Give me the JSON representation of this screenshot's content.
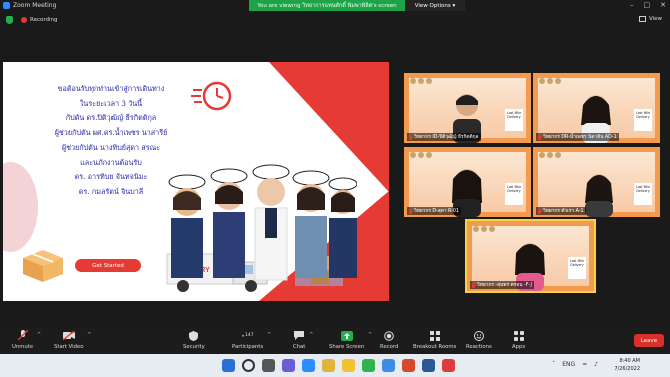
{
  "window": {
    "app_title": "Zoom Meeting",
    "banner_text": "You are viewing วิทยาการแทนศักดิ์ พิมพาพิลิต's screen",
    "view_options_label": "View Options",
    "view_label": "View",
    "recording_label": "Recording"
  },
  "slide": {
    "lines": [
      "ขอต้อนรับทุกท่านเข้าสู่การเดินทาง",
      "ในระยะเวลา 3 วันนี้",
      "กัปตัน ดร.ปิติวุฒิญ์ ธีรกิตติกุล",
      "ผู้ช่วยกัปตัน ผศ.ดร.น้ำเพชร นาสารีย์",
      "ผู้ช่วยกัปตัน นางทิบย์สุดา สรณะ",
      "และนภักงานต้อนรับ",
      "ดร. อารทิบย จันทจนิมะ",
      "ดร. กมลรัตน์ จินบาลี"
    ],
    "get_started_label": "Get Started",
    "truck_text": "DELIVERY"
  },
  "gallery": [
    {
      "name": "วิทยากร ID-ปิติวุฒิญ์ ธีรกิตติกุล",
      "sign": "Last Mile Delivery"
    },
    {
      "name": "วิทยากร DR-น้ำเพชร นิดาสิน AD-1",
      "sign": "Last Mile Delivery"
    },
    {
      "name": "วิทยากร D-สุดา R-01",
      "sign": "Last Mile Delivery"
    },
    {
      "name": "วิทยากร ตัวเรา A-1",
      "sign": "Last Mile Delivery"
    },
    {
      "name": "วิทยากร -สุนทร ครอน -F-J",
      "sign": "Last Mile Delivery"
    }
  ],
  "toolbar": {
    "unmute": "Unmute",
    "start_video": "Start Video",
    "security": "Security",
    "participants": "Participants",
    "participants_count": "147",
    "chat": "Chat",
    "share_screen": "Share Screen",
    "record": "Record",
    "breakout_rooms": "Breakout Rooms",
    "reactions": "Reactions",
    "apps": "Apps",
    "leave": "Leave"
  },
  "taskbar": {
    "time": "8:40 AM",
    "date": "7/26/2022",
    "lang": "ENG"
  },
  "colors": {
    "accent_red": "#e63a35",
    "zoom_green": "#1fa34a",
    "tile_orange": "#f39a4f",
    "active_speaker": "#f5d247"
  }
}
